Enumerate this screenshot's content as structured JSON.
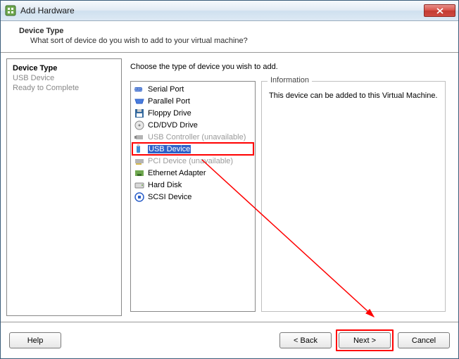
{
  "titlebar": {
    "title": "Add Hardware"
  },
  "header": {
    "title": "Device Type",
    "desc": "What sort of device do you wish to add to your virtual machine?"
  },
  "nav": {
    "items": [
      {
        "label": "Device Type",
        "active": true
      },
      {
        "label": "USB Device",
        "active": false
      },
      {
        "label": "Ready to Complete",
        "active": false
      }
    ]
  },
  "main": {
    "prompt": "Choose the type of device you wish to add.",
    "devices": [
      {
        "label": "Serial Port",
        "state": "normal"
      },
      {
        "label": "Parallel Port",
        "state": "normal"
      },
      {
        "label": "Floppy Drive",
        "state": "normal"
      },
      {
        "label": "CD/DVD Drive",
        "state": "normal"
      },
      {
        "label": "USB Controller (unavailable)",
        "state": "unavail"
      },
      {
        "label": "USB Device",
        "state": "selected"
      },
      {
        "label": "PCI Device (unavailable)",
        "state": "unavail"
      },
      {
        "label": "Ethernet Adapter",
        "state": "normal"
      },
      {
        "label": "Hard Disk",
        "state": "normal"
      },
      {
        "label": "SCSI Device",
        "state": "normal"
      }
    ],
    "info_legend": "Information",
    "info_text": "This device can be added to this Virtual Machine."
  },
  "footer": {
    "help": "Help",
    "back": "< Back",
    "next": "Next >",
    "cancel": "Cancel"
  },
  "annotation": {
    "highlight_selected": true,
    "highlight_next": true
  }
}
